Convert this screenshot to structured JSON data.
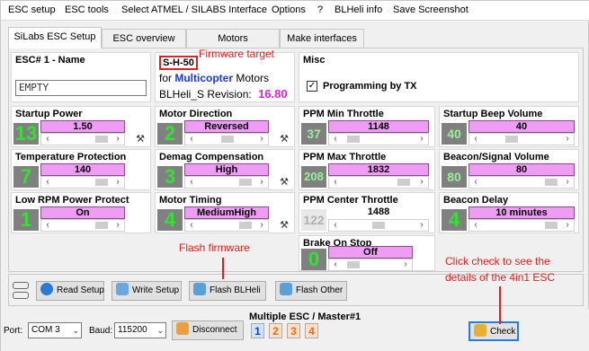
{
  "menu": [
    "ESC setup",
    "ESC tools",
    "Select ATMEL / SILABS Interface",
    "Options",
    "?",
    "BLHeli info",
    "Save Screenshot"
  ],
  "tabs": [
    "SiLabs ESC Setup",
    "ESC overview",
    "Motors",
    "Make interfaces"
  ],
  "esc_name": {
    "title": "ESC# 1 - Name",
    "value": "EMPTY"
  },
  "firmware": {
    "code": "S-H-50",
    "for_label": "for",
    "type": "Multicopter",
    "motors_label": "Motors",
    "revision_label": "BLHeli_S Revision:",
    "revision": "16.80"
  },
  "misc": {
    "title": "Misc",
    "programming_label": "Programming by TX",
    "programming_checked": true
  },
  "settings": {
    "startup_power": {
      "title": "Startup Power",
      "num": "13",
      "value": "1.50"
    },
    "motor_direction": {
      "title": "Motor Direction",
      "num": "2",
      "value": "Reversed"
    },
    "ppm_min": {
      "title": "PPM Min Throttle",
      "num": "37",
      "value": "1148"
    },
    "startup_beep": {
      "title": "Startup Beep Volume",
      "num": "40",
      "value": "40"
    },
    "temp_protection": {
      "title": "Temperature Protection",
      "num": "7",
      "value": "140"
    },
    "demag": {
      "title": "Demag Compensation",
      "num": "3",
      "value": "High"
    },
    "ppm_max": {
      "title": "PPM Max Throttle",
      "num": "208",
      "value": "1832"
    },
    "beacon_volume": {
      "title": "Beacon/Signal Volume",
      "num": "80",
      "value": "80"
    },
    "low_rpm": {
      "title": "Low RPM Power Protect",
      "num": "1",
      "value": "On"
    },
    "motor_timing": {
      "title": "Motor Timing",
      "num": "4",
      "value": "MediumHigh"
    },
    "ppm_center": {
      "title": "PPM Center Throttle",
      "num": "122",
      "value": "1488"
    },
    "beacon_delay": {
      "title": "Beacon Delay",
      "num": "4",
      "value": "10 minutes"
    },
    "brake_on_stop": {
      "title": "Brake On Stop",
      "num": "0",
      "value": "Off"
    }
  },
  "buttons": {
    "read": "Read Setup",
    "write": "Write Setup",
    "flash": "Flash BLHeli",
    "flash_other": "Flash Other",
    "disconnect": "Disconnect",
    "check": "Check"
  },
  "status": {
    "port_label": "Port:",
    "port": "COM 3",
    "baud_label": "Baud:",
    "baud": "115200",
    "multi_label": "Multiple ESC / Master#1",
    "esc_numbers": [
      "1",
      "2",
      "3",
      "4"
    ]
  },
  "annotations": {
    "firmware_target": "Firmware target",
    "flash_firmware": "Flash firmware",
    "check_line1": "Click check to see the",
    "check_line2": "details of the 4in1 ESC"
  },
  "colors": {
    "pink": "#ef9cf4",
    "green": "#32e232",
    "annotation_red": "#e02020",
    "revision_magenta": "#e020e0",
    "blue_text": "#1a3ad8"
  }
}
